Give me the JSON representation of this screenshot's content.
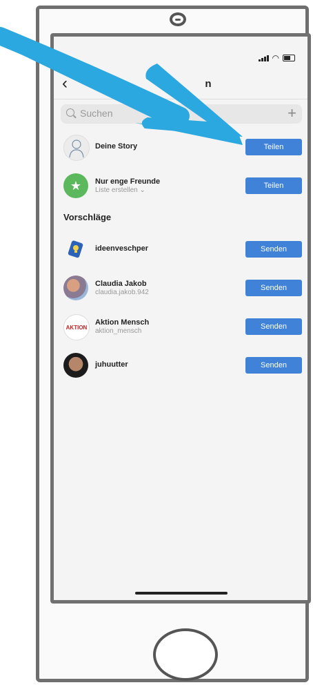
{
  "status_bar": {
    "icons": [
      "signal-icon",
      "wifi-icon",
      "battery-icon"
    ]
  },
  "nav": {
    "back_icon": "chevron-left-icon",
    "title_visible": "n"
  },
  "search": {
    "placeholder": "Suchen",
    "add_icon": "plus-icon"
  },
  "share_targets": [
    {
      "name": "Deine Story",
      "subtitle": "",
      "button": "Teilen",
      "avatar": "story-avatar"
    },
    {
      "name": "Nur enge Freunde",
      "subtitle": "Liste erstellen ⌄",
      "button": "Teilen",
      "avatar": "star-avatar"
    }
  ],
  "suggestions_header": "Vorschläge",
  "suggestions": [
    {
      "name": "ideenveschper",
      "subtitle": "",
      "button": "Senden",
      "avatar": "idea-avatar"
    },
    {
      "name": "Claudia Jakob",
      "subtitle": "claudia.jakob.942",
      "button": "Senden",
      "avatar": "photo-avatar"
    },
    {
      "name": "Aktion Mensch",
      "subtitle": "aktion_mensch",
      "button": "Senden",
      "avatar": "logo-avatar",
      "avatar_text": "AKTION"
    },
    {
      "name": "juhuutter",
      "subtitle": "",
      "button": "Senden",
      "avatar": "photo-avatar"
    }
  ],
  "colors": {
    "button_blue": "#3f82d8",
    "arrow_blue": "#2aa8df",
    "close_friends_green": "#5cb85c"
  }
}
